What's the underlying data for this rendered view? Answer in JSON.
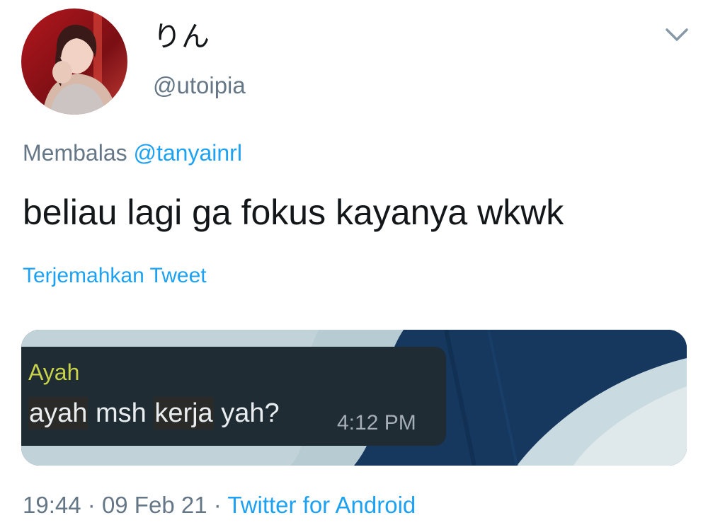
{
  "user": {
    "display_name": "りん",
    "handle": "@utoipia"
  },
  "reply": {
    "prefix": "Membalas",
    "mention": "@tanyainrl"
  },
  "tweet": {
    "text": "beliau lagi ga fokus kayanya wkwk",
    "translate_label": "Terjemahkan Tweet"
  },
  "media": {
    "chat": {
      "sender": "Ayah",
      "message_parts": [
        "ayah",
        "msh",
        "kerja",
        "yah?"
      ],
      "time": "4:12 PM"
    }
  },
  "meta": {
    "time": "19:44",
    "separator": "·",
    "date": "09 Feb 21",
    "source": "Twitter for Android"
  },
  "icons": {
    "menu": "chevron-down-icon"
  },
  "colors": {
    "link": "#1da1f2",
    "secondary_text": "#657786",
    "primary_text": "#14171a"
  }
}
